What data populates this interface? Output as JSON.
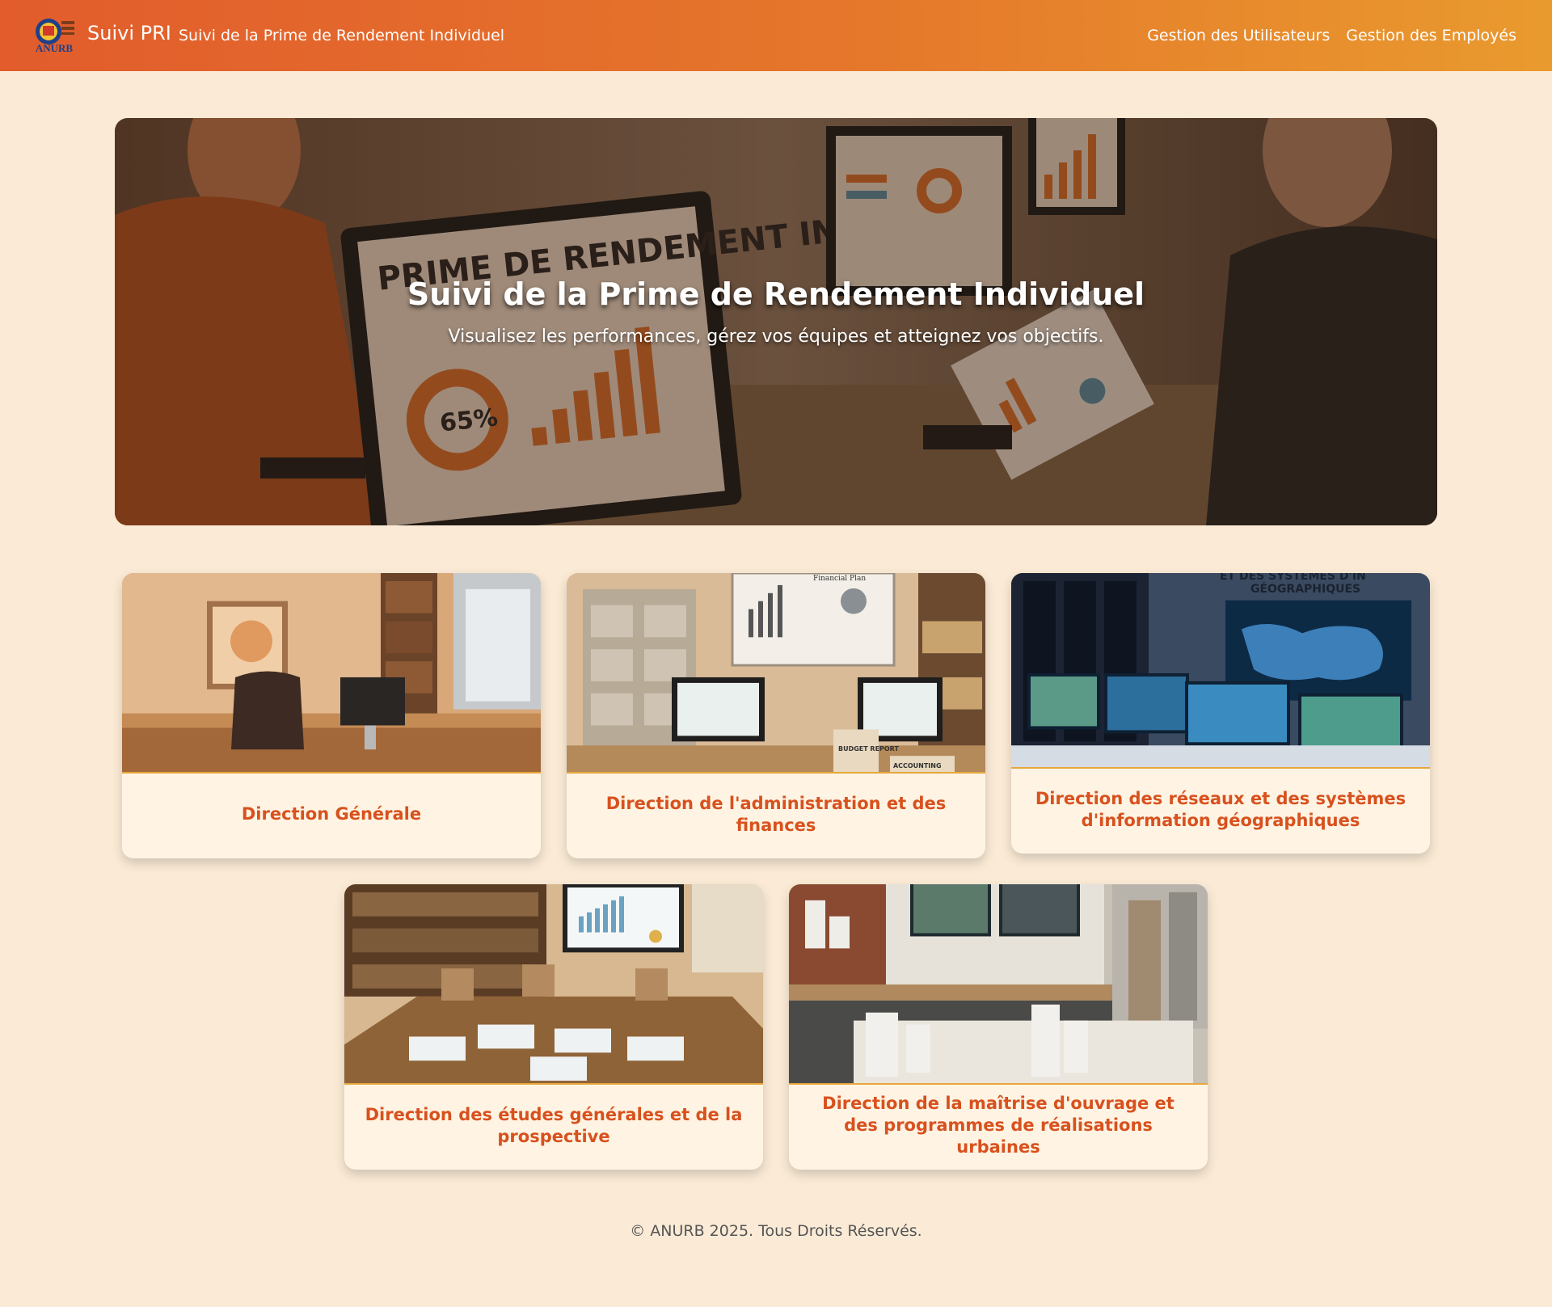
{
  "navbar": {
    "logo_text": "ANURB",
    "brand": "Suivi PRI",
    "tagline": "Suivi de la Prime de Rendement Individuel",
    "links": [
      "Gestion des Utilisateurs",
      "Gestion des Employés"
    ]
  },
  "hero": {
    "title": "Suivi de la Prime de Rendement Individuel",
    "subtitle": "Visualisez les performances, gérez vos équipes et atteignez vos objectifs.",
    "image_text": {
      "monitor_heading": "PRIME DE RENDEMENT INDIVIDUEL",
      "donut_value": "65%"
    }
  },
  "directions": [
    {
      "title": "Direction Générale"
    },
    {
      "title": "Direction de l'administration et des finances",
      "image_text": [
        "Financial Plan",
        "BUDGET REPORT",
        "ACCOUNTING"
      ]
    },
    {
      "title": "Direction des réseaux et des systèmes d'information géographiques",
      "image_text": [
        "ET DES SYSTÈMES D'IN",
        "GÉOGRAPHIQUES"
      ]
    },
    {
      "title": "Direction des études générales et de la prospective"
    },
    {
      "title": "Direction de la maîtrise d'ouvrage et des programmes de réalisations urbaines"
    }
  ],
  "footer": {
    "text": "© ANURB 2025. Tous Droits Réservés."
  },
  "colors": {
    "navbar_start": "#e25c2c",
    "navbar_end": "#e99a2e",
    "page_background": "#fbebd6",
    "card_background": "#fff4e3",
    "card_title": "#d8511e",
    "card_divider": "#e8a63a"
  }
}
